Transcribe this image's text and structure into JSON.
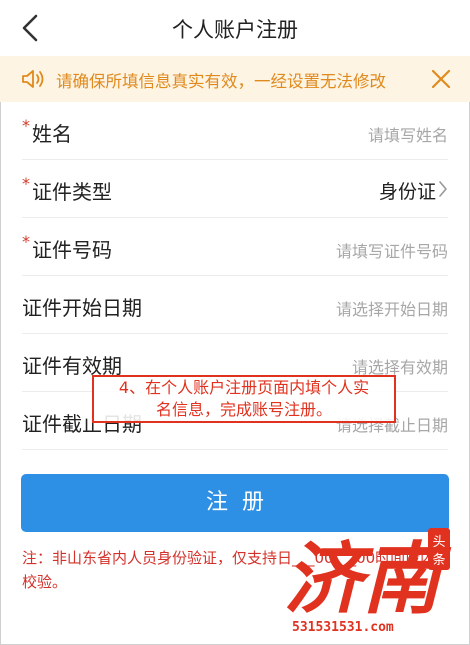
{
  "header": {
    "title": "个人账户注册",
    "back_icon": "back-chevron-icon"
  },
  "notice": {
    "text": "请确保所填信息真实有效，一经设置无法修改",
    "icon": "speaker-icon",
    "close_icon": "close-icon",
    "color": "#e08a1e",
    "background": "#fdf4e3"
  },
  "form": {
    "required_mark": "*",
    "rows": [
      {
        "label": "姓名",
        "placeholder": "请填写姓名",
        "required": true
      },
      {
        "label": "证件类型",
        "value": "身份证",
        "required": true
      },
      {
        "label": "证件号码",
        "placeholder": "请填写证件号码",
        "required": true
      },
      {
        "label": "证件开始日期",
        "placeholder": "请选择开始日期",
        "required": false
      },
      {
        "label": "证件有效期",
        "placeholder": "请选择有效期",
        "required": false
      },
      {
        "label": "证件截止日期",
        "placeholder": "请选择截止日期",
        "required": false
      }
    ]
  },
  "register_button": {
    "label": "注册",
    "color": "#2e90e4"
  },
  "note": {
    "text": "注：非山东省内人员身份验证，仅支持日___00___00时间段内校验。"
  },
  "annotation": {
    "line1": "4、在个人账户注册页面内填个人实",
    "line2": "名信息，完成账号注册。"
  },
  "watermark": {
    "brand": "济南",
    "tag": "头条",
    "domain": "531531531.com"
  }
}
